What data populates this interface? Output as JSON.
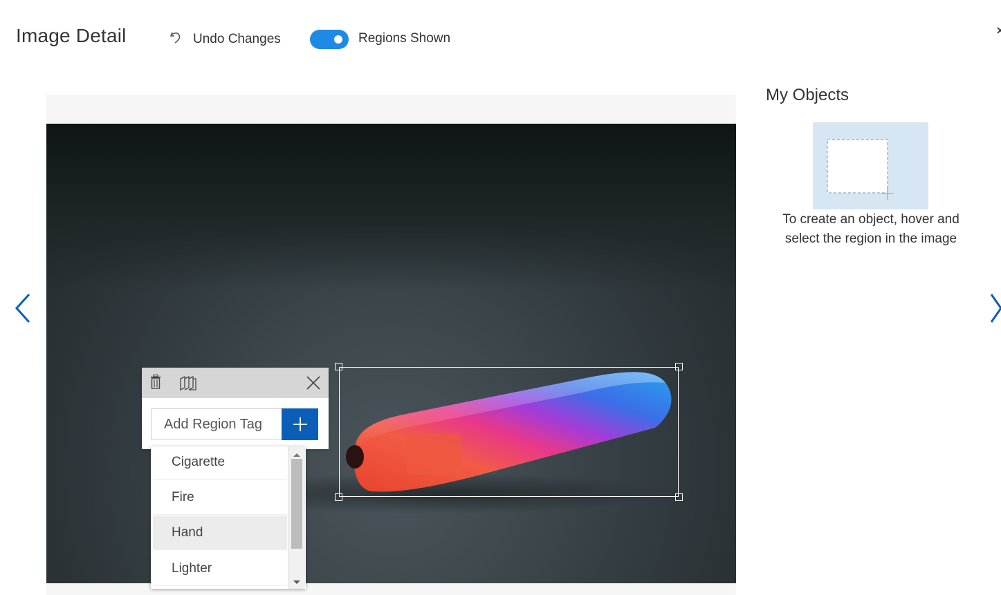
{
  "header": {
    "title": "Image Detail",
    "undo_label": "Undo Changes",
    "regions_label": "Regions Shown",
    "regions_toggle_on": true,
    "close_icon": "close-icon"
  },
  "popup": {
    "tag_placeholder": "Add Region Tag",
    "delete_icon": "trash-icon",
    "copy_icon": "copy-pages-icon",
    "close_icon": "close-icon",
    "add_icon": "plus-icon"
  },
  "dropdown": {
    "items": [
      "Cigarette",
      "Fire",
      "Hand",
      "Lighter"
    ],
    "highlighted": "Hand"
  },
  "objects": {
    "title": "My Objects",
    "hint": "To create an object, hover and select the region in the image"
  },
  "navigation": {
    "prev_icon": "chevron-left-icon",
    "next_icon": "chevron-right-icon"
  },
  "colors": {
    "accent": "#0a5eb8",
    "toggle": "#1e8ae6",
    "card": "#d6e6f3"
  }
}
